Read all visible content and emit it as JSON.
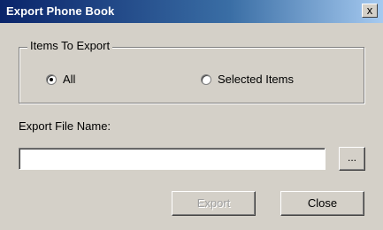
{
  "window": {
    "title": "Export Phone Book",
    "close_glyph": "x"
  },
  "items_group": {
    "legend": "Items To Export",
    "options": [
      {
        "label": "All",
        "selected": true
      },
      {
        "label": "Selected Items",
        "selected": false
      }
    ]
  },
  "file": {
    "label": "Export File Name:",
    "value": "",
    "browse_label": "..."
  },
  "buttons": {
    "export_label": "Export",
    "export_enabled": false,
    "close_label": "Close"
  },
  "colors": {
    "dialog_bg": "#d4d0c8",
    "titlebar_start": "#0a246a",
    "titlebar_end": "#a6caf0",
    "disabled_text": "#a0a0a0"
  }
}
